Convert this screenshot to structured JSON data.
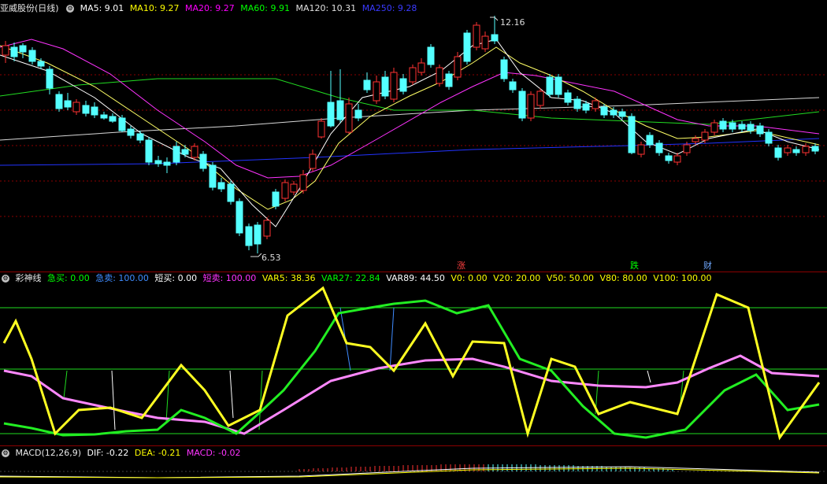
{
  "main": {
    "title": "亚威股份(日线)",
    "ma": [
      {
        "label": "MA5: 9.01",
        "color": "#ffffff"
      },
      {
        "label": "MA10: 9.27",
        "color": "#ffff00"
      },
      {
        "label": "MA20: 9.27",
        "color": "#ff00ff"
      },
      {
        "label": "MA60: 9.91",
        "color": "#00ff00"
      },
      {
        "label": "MA120: 10.31",
        "color": "#e0e0e0"
      },
      {
        "label": "MA250: 9.28",
        "color": "#3333ff"
      }
    ],
    "high_label": "12.16",
    "low_label": "6.53",
    "markers": [
      {
        "text": "涨",
        "color": "#ff4040"
      },
      {
        "text": "跌",
        "color": "#00ff00"
      },
      {
        "text": "财",
        "color": "#6fa8ff"
      }
    ]
  },
  "indicator": {
    "name": "彩神线",
    "values": [
      {
        "label": "急买: 0.00",
        "color": "#00ff00"
      },
      {
        "label": "急卖: 100.00",
        "color": "#3f8cff"
      },
      {
        "label": "短买: 0.00",
        "color": "#ffffff"
      },
      {
        "label": "短卖: 100.00",
        "color": "#ff33ff"
      },
      {
        "label": "VAR5: 38.36",
        "color": "#ffff00"
      },
      {
        "label": "VAR27: 22.84",
        "color": "#00ff00"
      },
      {
        "label": "VAR89: 44.50",
        "color": "#ffffff"
      },
      {
        "label": "V0: 0.00",
        "color": "#ffff00"
      },
      {
        "label": "V20: 20.00",
        "color": "#ffff00"
      },
      {
        "label": "V50: 50.00",
        "color": "#ffff00"
      },
      {
        "label": "V80: 80.00",
        "color": "#ffff00"
      },
      {
        "label": "V100: 100.00",
        "color": "#ffff00"
      }
    ]
  },
  "macd": {
    "name": "MACD(12,26,9)",
    "values": [
      {
        "label": "DIF: -0.22",
        "color": "#ffffff"
      },
      {
        "label": "DEA: -0.21",
        "color": "#ffff00"
      },
      {
        "label": "MACD: -0.02",
        "color": "#ff33ff"
      }
    ]
  },
  "colors": {
    "up": "#ff3232",
    "down": "#54ffff",
    "grid": "#8b0000"
  }
}
